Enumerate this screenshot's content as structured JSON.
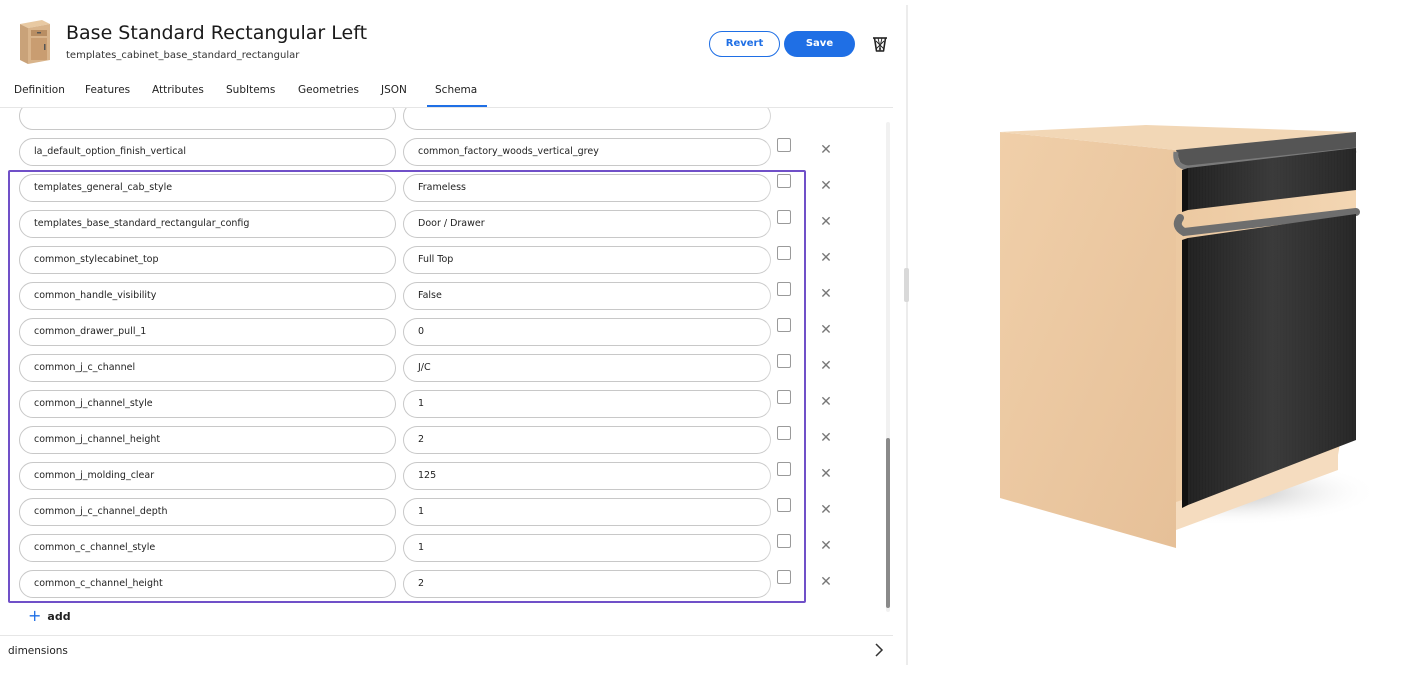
{
  "header": {
    "title": "Base Standard Rectangular Left",
    "subtitle": "templates_cabinet_base_standard_rectangular",
    "revert_label": "Revert",
    "save_label": "Save",
    "thumbnail_icon": "cabinet-thumbnail",
    "delete_icon": "trash-icon"
  },
  "tabs": [
    {
      "label": "Definition"
    },
    {
      "label": "Features"
    },
    {
      "label": "Attributes"
    },
    {
      "label": "SubItems"
    },
    {
      "label": "Geometries"
    },
    {
      "label": "JSON"
    },
    {
      "label": "Schema",
      "active": true
    }
  ],
  "rows": [
    {
      "key": "",
      "value": ""
    },
    {
      "key": "la_default_option_finish_vertical",
      "value": "common_factory_woods_vertical_grey"
    },
    {
      "key": "templates_general_cab_style",
      "value": "Frameless"
    },
    {
      "key": "templates_base_standard_rectangular_config",
      "value": "Door / Drawer"
    },
    {
      "key": "common_stylecabinet_top",
      "value": "Full Top"
    },
    {
      "key": "common_handle_visibility",
      "value": "False"
    },
    {
      "key": "common_drawer_pull_1",
      "value": "0"
    },
    {
      "key": "common_j_c_channel",
      "value": "J/C"
    },
    {
      "key": "common_j_channel_style",
      "value": "1"
    },
    {
      "key": "common_j_channel_height",
      "value": "2"
    },
    {
      "key": "common_j_molding_clear",
      "value": "125"
    },
    {
      "key": "common_j_c_channel_depth",
      "value": "1"
    },
    {
      "key": "common_c_channel_style",
      "value": "1"
    },
    {
      "key": "common_c_channel_height",
      "value": "2"
    }
  ],
  "add_label": "add",
  "dimensions_label": "dimensions",
  "colors": {
    "accent": "#1f6fe5",
    "highlight": "#7050c8",
    "wood": "#e9c7a0",
    "door": "#2b2b2b"
  }
}
